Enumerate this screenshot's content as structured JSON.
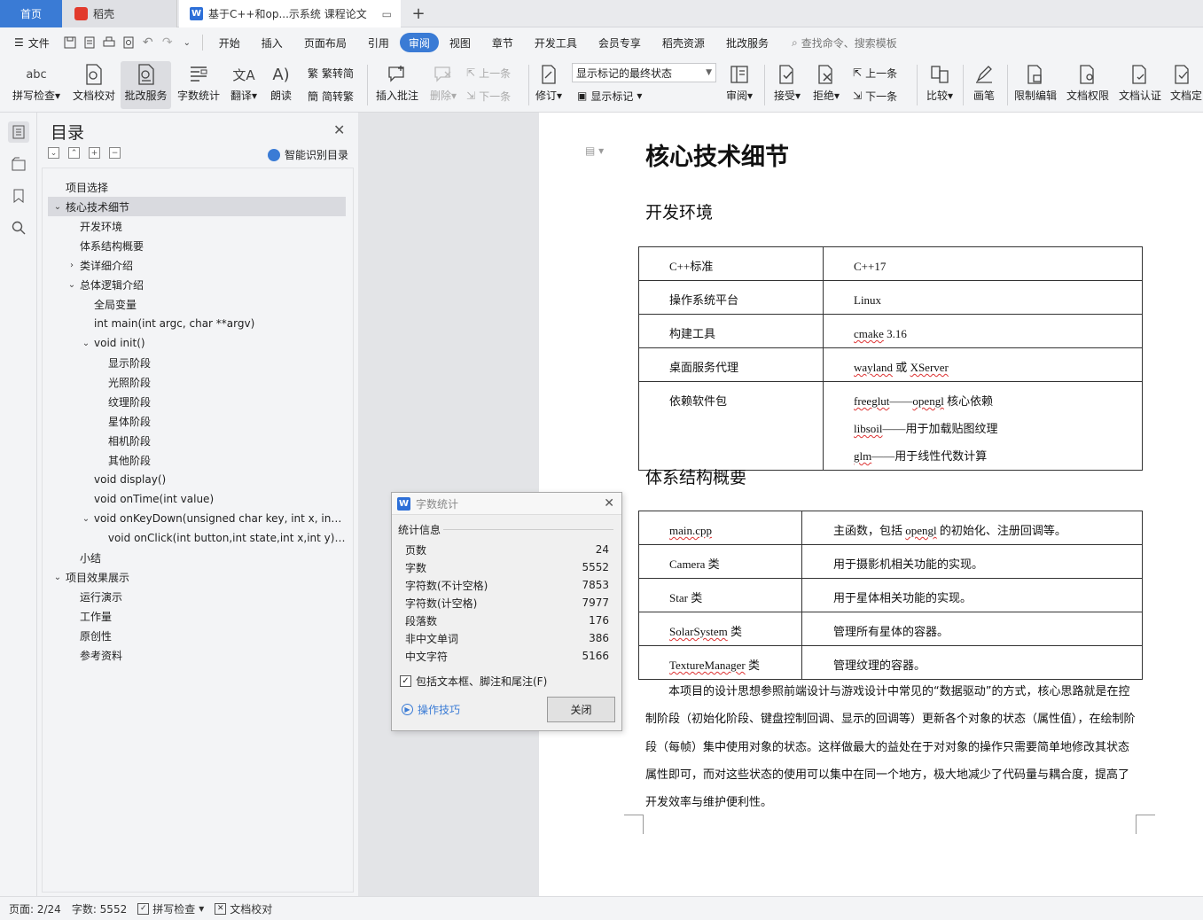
{
  "tabs": {
    "home": "首页",
    "daoke": "稻壳",
    "doc": "基于C++和op...示系统 课程论文",
    "add": "+"
  },
  "menubar": {
    "file": "文件",
    "items": [
      "开始",
      "插入",
      "页面布局",
      "引用",
      "审阅",
      "视图",
      "章节",
      "开发工具",
      "会员专享",
      "稻壳资源",
      "批改服务"
    ],
    "active": "审阅",
    "search": "查找命令、搜索模板"
  },
  "ribbon": {
    "spell": "拼写检查",
    "proof": "文档校对",
    "review_service": "批改服务",
    "word_count": "字数统计",
    "translate": "翻译",
    "read": "朗读",
    "trad": "繁转简",
    "simp": "简转繁",
    "insert_comment": "插入批注",
    "delete": "删除",
    "prev": "上一条",
    "next": "下一条",
    "revise": "修订",
    "markup_state": "显示标记的最终状态",
    "show_markup": "显示标记",
    "review": "审阅",
    "accept": "接受",
    "reject": "拒绝",
    "prev2": "上一条",
    "next2": "下一条",
    "compare": "比较",
    "pen": "画笔",
    "restrict": "限制编辑",
    "permission": "文档权限",
    "certify": "文档认证",
    "finalize": "文档定"
  },
  "toc": {
    "title": "目录",
    "smart": "智能识别目录",
    "items": [
      {
        "label": "项目选择",
        "arrow": ""
      },
      {
        "label": "核心技术细节",
        "arrow": "⌄"
      },
      {
        "label": "开发环境",
        "arrow": ""
      },
      {
        "label": "体系结构概要",
        "arrow": ""
      },
      {
        "label": "类详细介绍",
        "arrow": "›"
      },
      {
        "label": "总体逻辑介绍",
        "arrow": "⌄"
      },
      {
        "label": "全局变量",
        "arrow": ""
      },
      {
        "label": "int main(int argc, char **argv)",
        "arrow": ""
      },
      {
        "label": "void init()",
        "arrow": "⌄"
      },
      {
        "label": "显示阶段",
        "arrow": ""
      },
      {
        "label": "光照阶段",
        "arrow": ""
      },
      {
        "label": "纹理阶段",
        "arrow": ""
      },
      {
        "label": "星体阶段",
        "arrow": ""
      },
      {
        "label": "相机阶段",
        "arrow": ""
      },
      {
        "label": "其他阶段",
        "arrow": ""
      },
      {
        "label": "void display()",
        "arrow": ""
      },
      {
        "label": "void onTime(int value)",
        "arrow": ""
      },
      {
        "label": "void onKeyDown(unsigned char key, int x, int ...",
        "arrow": "⌄"
      },
      {
        "label": "void onClick(int button,int state,int x,int y) ...",
        "arrow": ""
      },
      {
        "label": "小结",
        "arrow": ""
      },
      {
        "label": "项目效果展示",
        "arrow": "⌄"
      },
      {
        "label": "运行演示",
        "arrow": ""
      },
      {
        "label": "工作量",
        "arrow": ""
      },
      {
        "label": "原创性",
        "arrow": ""
      },
      {
        "label": "参考资料",
        "arrow": ""
      }
    ]
  },
  "doc": {
    "h1": "核心技术细节",
    "h2_env": "开发环境",
    "env_table": {
      "cpp_label": "C++标准",
      "cpp_val": "C++17",
      "os_label": "操作系统平台",
      "os_val": "Linux",
      "build_label": "构建工具",
      "build_val_a": "cmake",
      "build_val_b": " 3.16",
      "desk_label": "桌面服务代理",
      "desk_val_a": "wayland",
      "desk_val_b": " 或 ",
      "desk_val_c": "XServer",
      "dep_label": "依赖软件包",
      "dep1_a": "freeglut",
      "dep1_b": "——",
      "dep1_c": "opengl",
      "dep1_d": " 核心依赖",
      "dep2_a": "libsoil",
      "dep2_b": "——用于加载贴图纹理",
      "dep3_a": "glm",
      "dep3_b": "——用于线性代数计算"
    },
    "h2_arch": "体系结构概要",
    "arch_table": {
      "r1_a": "main.cpp",
      "r1_b1": "主函数，包括 ",
      "r1_b2": "opengl",
      "r1_b3": " 的初始化、注册回调等。",
      "r2_a": "Camera 类",
      "r2_b": "用于摄影机相关功能的实现。",
      "r3_a": "Star 类",
      "r3_b": "用于星体相关功能的实现。",
      "r4_a1": "SolarSystem",
      "r4_a2": " 类",
      "r4_b": "管理所有星体的容器。",
      "r5_a1": "TextureManager",
      "r5_a2": " 类",
      "r5_b": "管理纹理的容器。"
    },
    "paragraph": "本项目的设计思想参照前端设计与游戏设计中常见的“数据驱动”的方式，核心思路就是在控制阶段（初始化阶段、键盘控制回调、显示的回调等）更新各个对象的状态（属性值），在绘制阶段（每帧）集中使用对象的状态。这样做最大的益处在于对对象的操作只需要简单地修改其状态属性即可，而对这些状态的使用可以集中在同一个地方，极大地减少了代码量与耦合度，提高了开发效率与维护便利性。"
  },
  "dialog": {
    "title": "字数统计",
    "section": "统计信息",
    "stats": [
      {
        "label": "页数",
        "value": "24"
      },
      {
        "label": "字数",
        "value": "5552"
      },
      {
        "label": "字符数(不计空格)",
        "value": "7853"
      },
      {
        "label": "字符数(计空格)",
        "value": "7977"
      },
      {
        "label": "段落数",
        "value": "176"
      },
      {
        "label": "非中文单词",
        "value": "386"
      },
      {
        "label": "中文字符",
        "value": "5166"
      }
    ],
    "include": "包括文本框、脚注和尾注(F)",
    "tips": "操作技巧",
    "close": "关闭"
  },
  "status": {
    "page": "页面: 2/24",
    "words": "字数: 5552",
    "spell": "拼写检查",
    "proof": "文档校对"
  },
  "colors": {
    "accent": "#3a7bd5",
    "wavy": "#d33"
  }
}
